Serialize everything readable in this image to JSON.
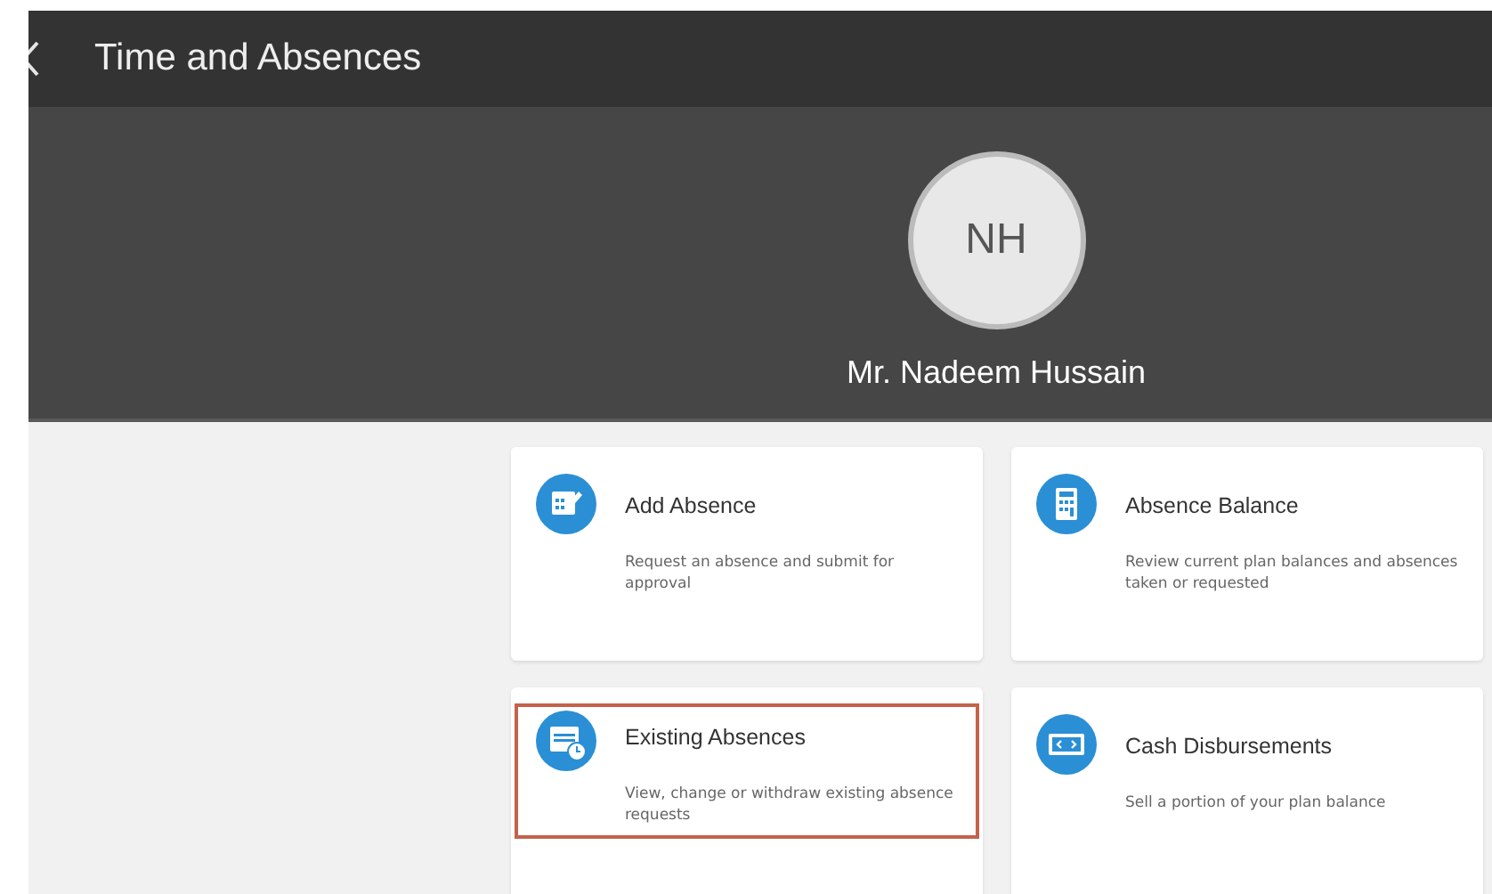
{
  "header": {
    "title": "Time and Absences"
  },
  "profile": {
    "initials": "NH",
    "name": "Mr. Nadeem Hussain"
  },
  "cards": [
    {
      "kind": "calendar-edit",
      "title": "Add Absence",
      "description": "Request an absence and submit for approval",
      "selected": false
    },
    {
      "kind": "calculator",
      "title": "Absence Balance",
      "description": "Review current plan balances and absences taken or requested",
      "selected": false
    },
    {
      "kind": "calendar-clock",
      "title": "Existing Absences",
      "description": "View, change or withdraw existing absence requests",
      "selected": true
    },
    {
      "kind": "banknote",
      "title": "Cash Disbursements",
      "description": "Sell a portion of your plan balance",
      "selected": false
    }
  ]
}
